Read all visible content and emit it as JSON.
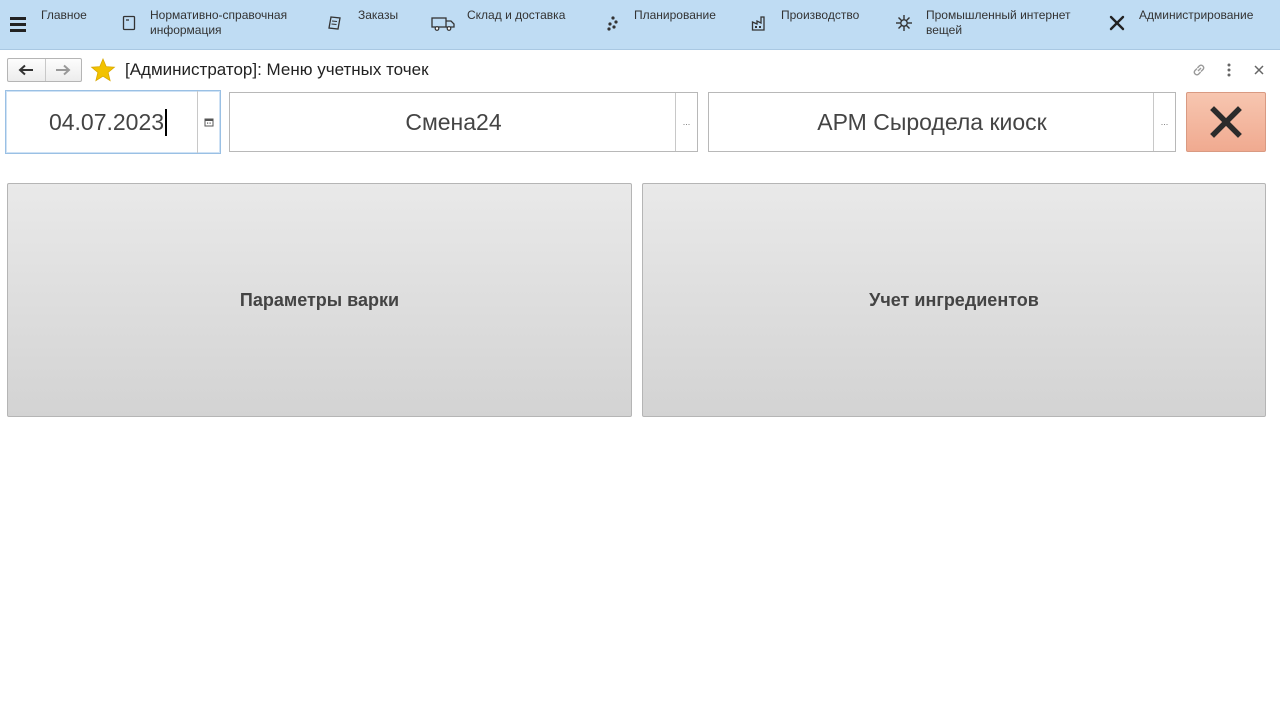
{
  "sections": [
    {
      "label": "Главное",
      "icon": "home-icon"
    },
    {
      "label": "Нормативно-справочная\nинформация",
      "icon": "reference-book-icon"
    },
    {
      "label": "Заказы",
      "icon": "orders-icon"
    },
    {
      "label": "Склад и доставка",
      "icon": "truck-icon"
    },
    {
      "label": "Планирование",
      "icon": "planning-icon"
    },
    {
      "label": "Производство",
      "icon": "factory-icon"
    },
    {
      "label": "Промышленный интернет\nвещей",
      "icon": "iot-icon"
    },
    {
      "label": "Администрирование",
      "icon": "tools-icon"
    }
  ],
  "header": {
    "title": "[Администратор]: Меню учетных точек"
  },
  "fields": {
    "date": "04.07.2023",
    "shift": "Смена24",
    "workplace": "АРМ Сыродела киоск",
    "choice_label": "..."
  },
  "buttons": {
    "brewing_params": "Параметры варки",
    "ingredients": "Учет ингредиентов"
  },
  "colors": {
    "topbar": "#bfdcf3",
    "star": "#f2c200",
    "close_button": "#f2b39b"
  }
}
